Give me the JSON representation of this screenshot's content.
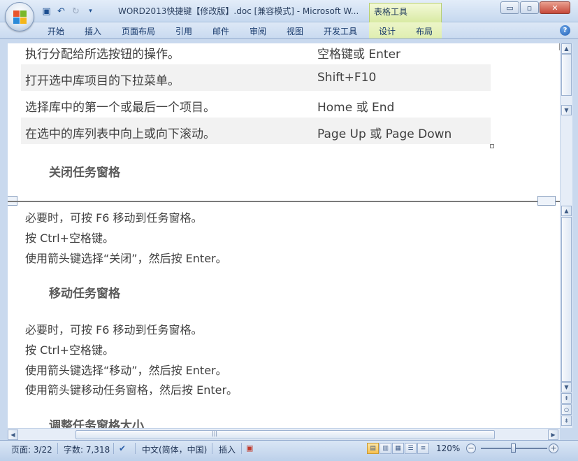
{
  "window": {
    "title": "WORD2013快捷键【修改版】.doc [兼容模式] - Microsoft W...",
    "context_tab": "表格工具",
    "controls": {
      "minimize": "▭",
      "maximize": "▫",
      "close": "✕"
    }
  },
  "quick_access": [
    "save-icon",
    "undo-icon",
    "redo-icon",
    "customize-icon"
  ],
  "ribbon": {
    "tabs": [
      "开始",
      "插入",
      "页面布局",
      "引用",
      "邮件",
      "审阅",
      "视图",
      "开发工具"
    ],
    "context_tabs": [
      "设计",
      "布局"
    ],
    "help": "?"
  },
  "document": {
    "table_rows": [
      {
        "action": "执行分配给所选按钮的操作。",
        "key": "空格键或 Enter"
      },
      {
        "action": "打开选中库项目的下拉菜单。",
        "key": "Shift+F10"
      },
      {
        "action": "选择库中的第一个或最后一个项目。",
        "key": "Home 或 End"
      },
      {
        "action": "在选中的库列表中向上或向下滚动。",
        "key": "Page Up 或 Page Down"
      }
    ],
    "heading_close": "关闭任务窗格",
    "close_steps": [
      "必要时，可按 F6 移动到任务窗格。",
      "按 Ctrl+空格键。",
      "使用箭头键选择“关闭”，然后按 Enter。"
    ],
    "heading_move": "移动任务窗格",
    "move_steps": [
      "必要时，可按 F6 移动到任务窗格。",
      "按 Ctrl+空格键。",
      "使用箭头键选择“移动”，然后按 Enter。",
      "使用箭头键移动任务窗格，然后按 Enter。"
    ],
    "heading_resize": "调整任务窗格大小"
  },
  "status_bar": {
    "page": "页面: 3/22",
    "words": "字数: 7,318",
    "language": "中文(简体，中国)",
    "mode": "插入",
    "zoom": "120%",
    "zoom_level": 0.5
  },
  "colors": {
    "accent": "#1d4f91",
    "context_tab": "#d9eaa3",
    "active_view": "#f7c04f"
  }
}
